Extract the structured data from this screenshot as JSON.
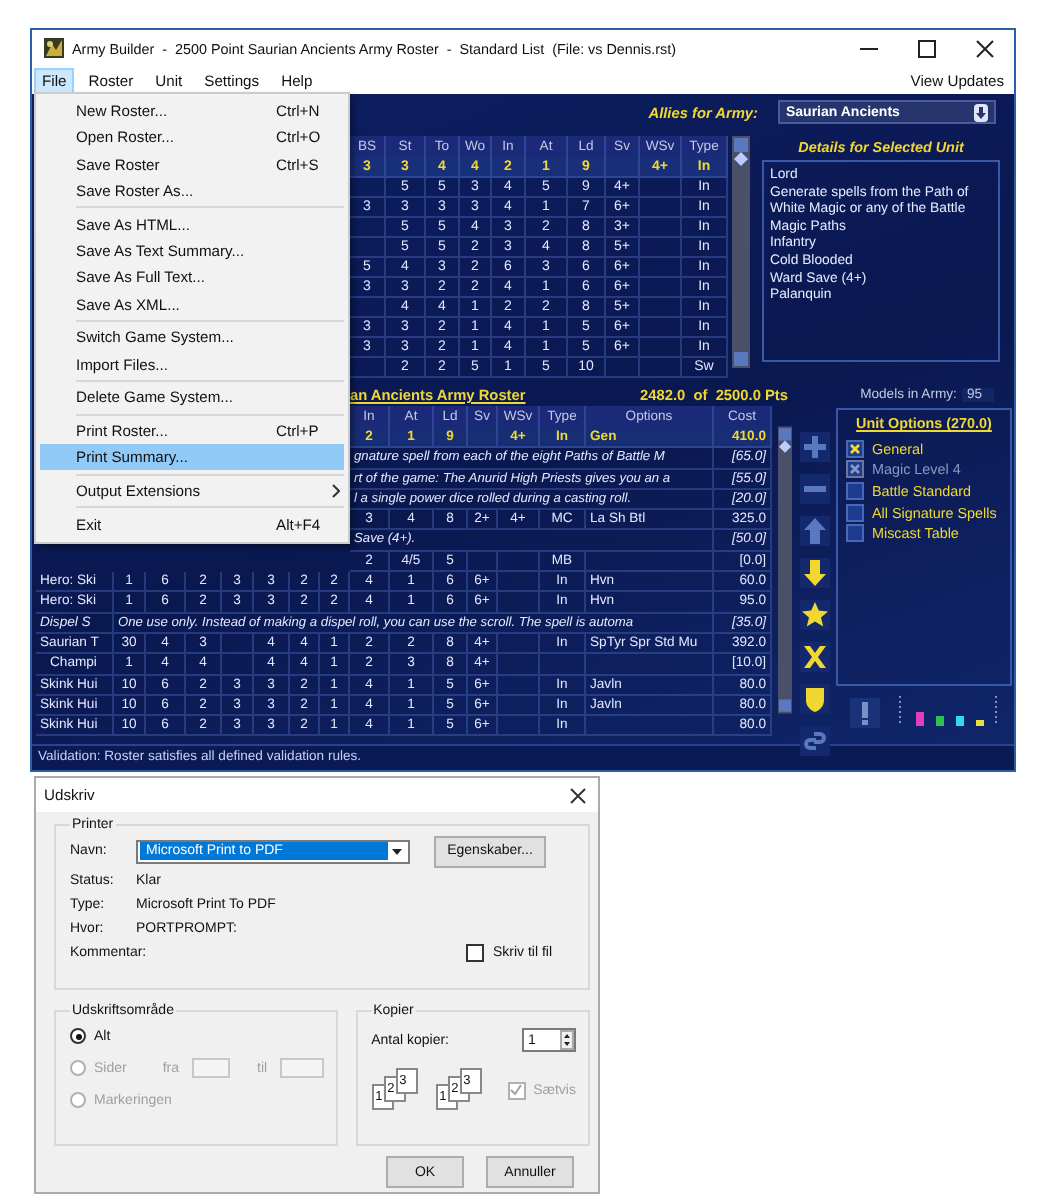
{
  "window": {
    "title": "Army Builder  -  2500 Point Saurian Ancients Army Roster  -  Standard List  (File: vs Dennis.rst)"
  },
  "menubar": {
    "items": [
      {
        "label": "File",
        "selected": true
      },
      {
        "label": "Roster",
        "selected": false
      },
      {
        "label": "Unit",
        "selected": false
      },
      {
        "label": "Settings",
        "selected": false
      },
      {
        "label": "Help",
        "selected": false
      }
    ],
    "updates_link": "View Updates"
  },
  "file_menu": [
    {
      "kind": "item",
      "label": "New Roster...",
      "shortcut": "Ctrl+N",
      "selected": false
    },
    {
      "kind": "item",
      "label": "Open Roster...",
      "shortcut": "Ctrl+O",
      "selected": false
    },
    {
      "kind": "item",
      "label": "Save Roster",
      "shortcut": "Ctrl+S",
      "selected": false
    },
    {
      "kind": "item",
      "label": "Save Roster As...",
      "selected": false
    },
    {
      "kind": "separator"
    },
    {
      "kind": "item",
      "label": "Save As HTML...",
      "selected": false
    },
    {
      "kind": "item",
      "label": "Save As Text Summary...",
      "selected": false
    },
    {
      "kind": "item",
      "label": "Save As Full Text...",
      "selected": false
    },
    {
      "kind": "item",
      "label": "Save As XML...",
      "selected": false
    },
    {
      "kind": "separator"
    },
    {
      "kind": "item",
      "label": "Switch Game System...",
      "selected": false
    },
    {
      "kind": "item",
      "label": "Import Files...",
      "selected": false
    },
    {
      "kind": "separator"
    },
    {
      "kind": "item",
      "label": "Delete Game System...",
      "selected": false
    },
    {
      "kind": "separator"
    },
    {
      "kind": "item",
      "label": "Print Roster...",
      "shortcut": "Ctrl+P",
      "selected": false
    },
    {
      "kind": "item",
      "label": "Print Summary...",
      "selected": true
    },
    {
      "kind": "separator"
    },
    {
      "kind": "item",
      "label": "Output Extensions",
      "submenu": true,
      "selected": false
    },
    {
      "kind": "separator"
    },
    {
      "kind": "item",
      "label": "Exit",
      "shortcut": "Alt+F4",
      "selected": false
    }
  ],
  "allies": {
    "label": "Allies for Army:",
    "value": "Saurian Ancients"
  },
  "unit_table": {
    "columns": [
      "BS",
      "St",
      "To",
      "Wo",
      "In",
      "At",
      "Ld",
      "Sv",
      "WSv",
      "Type"
    ],
    "rows": [
      {
        "selected": true,
        "cells": [
          "3",
          "3",
          "4",
          "4",
          "2",
          "1",
          "9",
          null,
          "4+",
          "In"
        ]
      },
      {
        "selected": false,
        "cells": [
          null,
          "5",
          "5",
          "3",
          "4",
          "5",
          "9",
          "4+",
          null,
          "In"
        ]
      },
      {
        "selected": false,
        "cells": [
          "3",
          "3",
          "3",
          "3",
          "4",
          "1",
          "7",
          "6+",
          null,
          "In"
        ]
      },
      {
        "selected": false,
        "cells": [
          null,
          "5",
          "5",
          "4",
          "3",
          "2",
          "8",
          "3+",
          null,
          "In"
        ]
      },
      {
        "selected": false,
        "cells": [
          null,
          "5",
          "5",
          "2",
          "3",
          "4",
          "8",
          "5+",
          null,
          "In"
        ]
      },
      {
        "selected": false,
        "cells": [
          "5",
          "4",
          "3",
          "2",
          "6",
          "3",
          "6",
          "6+",
          null,
          "In"
        ]
      },
      {
        "selected": false,
        "cells": [
          "3",
          "3",
          "2",
          "2",
          "4",
          "1",
          "6",
          "6+",
          null,
          "In"
        ]
      },
      {
        "selected": false,
        "cells": [
          null,
          "4",
          "4",
          "1",
          "2",
          "2",
          "8",
          "5+",
          null,
          "In"
        ]
      },
      {
        "selected": false,
        "cells": [
          "3",
          "3",
          "2",
          "1",
          "4",
          "1",
          "5",
          "6+",
          null,
          "In"
        ]
      },
      {
        "selected": false,
        "cells": [
          "3",
          "3",
          "2",
          "1",
          "4",
          "1",
          "5",
          "6+",
          null,
          "In"
        ]
      },
      {
        "selected": false,
        "cells": [
          null,
          "2",
          "2",
          "5",
          "1",
          "5",
          "10",
          null,
          null,
          "Sw"
        ]
      }
    ]
  },
  "details": {
    "title": "Details for Selected Unit",
    "lines": [
      "Lord",
      "Generate spells from the Path of White Magic or any of the Battle Magic Paths",
      "Infantry",
      "Cold Blooded",
      "Ward Save (4+)",
      "Palanquin"
    ]
  },
  "roster": {
    "title": "an Ancients Army Roster",
    "points": "2482.0  of  2500.0 Pts",
    "columns": [
      null,
      null,
      null,
      null,
      null,
      null,
      null,
      null,
      "In",
      "At",
      "Ld",
      "Sv",
      "WSv",
      "Type",
      "Options",
      "Cost"
    ],
    "rows": [
      {
        "kind": "unit",
        "selected": true,
        "cells": [
          null,
          null,
          null,
          null,
          null,
          null,
          null,
          null,
          "2",
          "1",
          "9",
          null,
          "4+",
          "In",
          "Gen",
          "410.0"
        ]
      },
      {
        "kind": "note",
        "selected": false,
        "text": "gnature spell from each of the eight Paths of Battle M",
        "cost": "[65.0]"
      },
      {
        "kind": "note",
        "selected": false,
        "text": "rt of the game: The Anurid High Priests gives you an a",
        "cost": "[55.0]"
      },
      {
        "kind": "note",
        "selected": false,
        "text": "l a single power dice rolled during a casting roll.",
        "cost": "[20.0]"
      },
      {
        "kind": "unit",
        "selected": false,
        "cells": [
          null,
          null,
          null,
          null,
          null,
          null,
          null,
          null,
          "3",
          "4",
          "8",
          "2+",
          "4+",
          "MC",
          "La Sh Btl",
          "325.0"
        ]
      },
      {
        "kind": "note",
        "selected": false,
        "text": "Save (4+).",
        "cost": "[50.0]"
      },
      {
        "kind": "unit",
        "selected": false,
        "cells": [
          null,
          null,
          null,
          null,
          null,
          null,
          null,
          null,
          "2",
          "4/5",
          "5",
          null,
          null,
          "MB",
          null,
          "[0.0]"
        ]
      },
      {
        "kind": "unit",
        "selected": false,
        "cells": [
          "Hero: Ski",
          "1",
          "6",
          "2",
          "3",
          "3",
          "2",
          "2",
          "4",
          "1",
          "6",
          "6+",
          null,
          "In",
          "Hvn",
          "60.0"
        ]
      },
      {
        "kind": "unit",
        "selected": false,
        "cells": [
          "Hero: Ski",
          "1",
          "6",
          "2",
          "3",
          "3",
          "2",
          "2",
          "4",
          "1",
          "6",
          "6+",
          null,
          "In",
          "Hvn",
          "95.0"
        ]
      },
      {
        "kind": "note",
        "selected": false,
        "name": "Dispel S",
        "text": "One use only. Instead of making a dispel roll, you can use the scroll. The spell is automa",
        "cost": "[35.0]"
      },
      {
        "kind": "unit",
        "selected": false,
        "cells": [
          "Saurian T",
          "30",
          "4",
          "3",
          null,
          "4",
          "4",
          "1",
          "2",
          "2",
          "8",
          "4+",
          null,
          "In",
          "SpTyr Spr Std Mu",
          "392.0"
        ]
      },
      {
        "kind": "sub",
        "selected": false,
        "cells": [
          "Champi",
          "1",
          "4",
          "4",
          null,
          "4",
          "4",
          "1",
          "2",
          "3",
          "8",
          "4+",
          null,
          null,
          null,
          "[10.0]"
        ]
      },
      {
        "kind": "unit",
        "selected": false,
        "cells": [
          "Skink Hui",
          "10",
          "6",
          "2",
          "3",
          "3",
          "2",
          "1",
          "4",
          "1",
          "5",
          "6+",
          null,
          "In",
          "Javln",
          "80.0"
        ]
      },
      {
        "kind": "unit",
        "selected": false,
        "cells": [
          "Skink Hui",
          "10",
          "6",
          "2",
          "3",
          "3",
          "2",
          "1",
          "4",
          "1",
          "5",
          "6+",
          null,
          "In",
          "Javln",
          "80.0"
        ]
      },
      {
        "kind": "unit",
        "selected": false,
        "cells": [
          "Skink Hui",
          "10",
          "6",
          "2",
          "3",
          "3",
          "2",
          "1",
          "4",
          "1",
          "5",
          "6+",
          null,
          "In",
          null,
          "80.0"
        ]
      }
    ]
  },
  "tools": [
    {
      "kind": "add",
      "disabled": true
    },
    {
      "kind": "remove",
      "disabled": true
    },
    {
      "kind": "up",
      "disabled": true
    },
    {
      "kind": "down",
      "disabled": false
    },
    {
      "kind": "star",
      "disabled": false
    },
    {
      "kind": "delete",
      "disabled": false
    },
    {
      "kind": "shield",
      "disabled": false
    },
    {
      "kind": "link",
      "disabled": true
    }
  ],
  "models": {
    "label": "Models in Army:",
    "value": "95"
  },
  "unit_options": {
    "title": "Unit Options (270.0)",
    "items": [
      {
        "label": "General",
        "checked": true,
        "disabled": false
      },
      {
        "label": "Magic Level 4",
        "checked": true,
        "disabled": true
      },
      {
        "label": "Battle Standard",
        "checked": false,
        "disabled": false
      },
      {
        "label": "All Signature Spells",
        "checked": false,
        "disabled": false
      },
      {
        "label": "Miscast Table",
        "checked": false,
        "disabled": false
      }
    ]
  },
  "status_bar": "Validation: Roster satisfies all defined validation rules.",
  "dialog": {
    "title": "Udskriv",
    "printer": {
      "legend": "Printer",
      "name_label": "Navn:",
      "name_value": "Microsoft Print to PDF",
      "properties_button": "Egenskaber...",
      "info": [
        {
          "label": "Status:",
          "value": "Klar"
        },
        {
          "label": "Type:",
          "value": "Microsoft Print To PDF"
        },
        {
          "label": "Hvor:",
          "value": "PORTPROMPT:"
        },
        {
          "label": "Kommentar:"
        }
      ],
      "print_to_file": {
        "label": "Skriv til fil",
        "checked": false
      }
    },
    "range": {
      "legend": "Udskriftsområde",
      "options": [
        {
          "label": "Alt",
          "selected": true,
          "disabled": false
        },
        {
          "label": "Sider",
          "selected": false,
          "disabled": true,
          "from_label": "fra",
          "to_label": "til"
        },
        {
          "label": "Markeringen",
          "selected": false,
          "disabled": true
        }
      ]
    },
    "copies": {
      "legend": "Kopier",
      "count_label": "Antal kopier:",
      "count": "1",
      "collate_icons": [
        [
          "1",
          "2",
          "3"
        ],
        [
          "1",
          "2",
          "3"
        ]
      ],
      "collate": {
        "label": "Sætvis",
        "checked": true,
        "disabled": true
      }
    },
    "buttons": [
      "OK",
      "Annuller"
    ]
  }
}
